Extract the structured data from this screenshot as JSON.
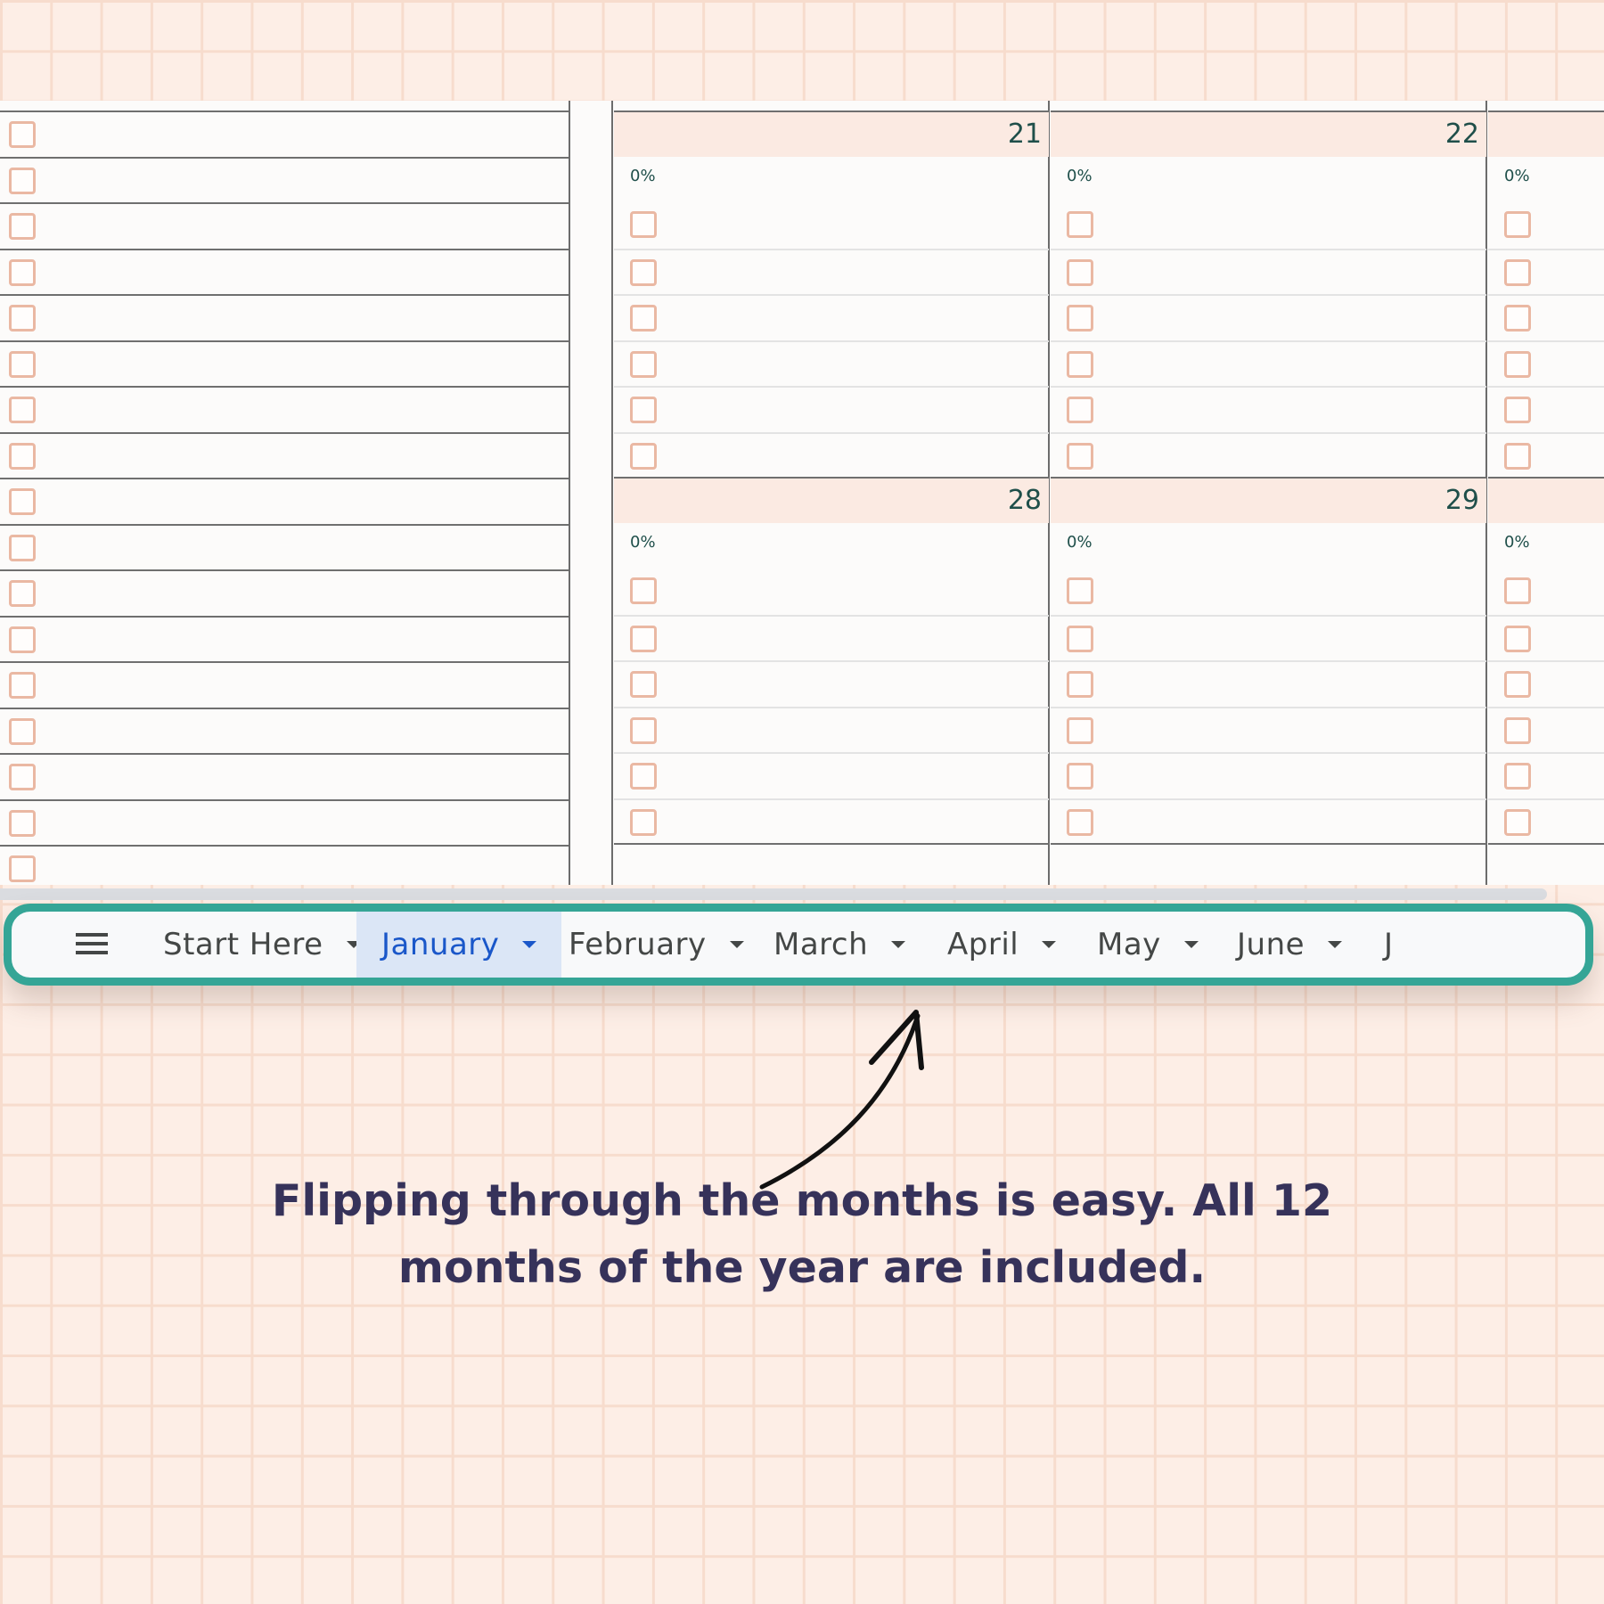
{
  "sheet": {
    "left_rows": 17,
    "weeks": [
      {
        "days": [
          {
            "number": "21",
            "progress": "0%"
          },
          {
            "number": "22",
            "progress": "0%"
          },
          {
            "number": "",
            "progress": "0%"
          }
        ],
        "tasks_per_day": 6
      },
      {
        "days": [
          {
            "number": "28",
            "progress": "0%"
          },
          {
            "number": "29",
            "progress": "0%"
          },
          {
            "number": "",
            "progress": "0%"
          }
        ],
        "tasks_per_day": 6
      }
    ]
  },
  "tabs": {
    "menu_icon": "hamburger-menu-icon",
    "items": [
      {
        "label": "Start Here",
        "active": false
      },
      {
        "label": "January",
        "active": true
      },
      {
        "label": "February",
        "active": false
      },
      {
        "label": "March",
        "active": false
      },
      {
        "label": "April",
        "active": false
      },
      {
        "label": "May",
        "active": false
      },
      {
        "label": "June",
        "active": false
      },
      {
        "label": "J",
        "active": false
      }
    ]
  },
  "caption": {
    "line1": "Flipping through the months is easy. All 12",
    "line2": "months of the year are included."
  },
  "colors": {
    "accent": "#35a596",
    "active_tab": "#1a57c9",
    "checkbox": "#eab8a3",
    "caption": "#36325a"
  }
}
